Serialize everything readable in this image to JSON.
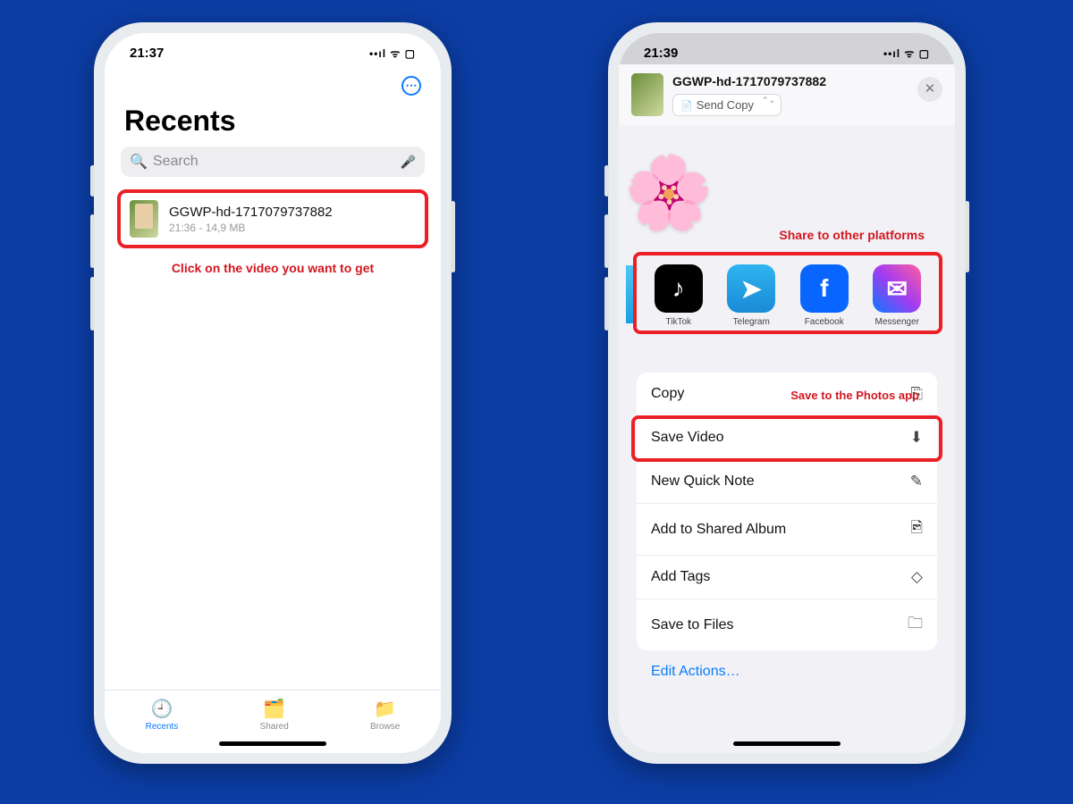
{
  "left": {
    "time": "21:37",
    "signal": "••ıl ᯤ ▢",
    "title": "Recents",
    "search_placeholder": "Search",
    "file": {
      "name": "GGWP-hd-1717079737882",
      "meta": "21:36 - 14,9 MB"
    },
    "caption": "Click on the video you want to get",
    "tabs": {
      "recents": "Recents",
      "shared": "Shared",
      "browse": "Browse"
    }
  },
  "right": {
    "time": "21:39",
    "signal": "••ıl ᯤ ▢",
    "file_name": "GGWP-hd-1717079737882",
    "send_copy": "Send Copy",
    "caption_share": "Share to other platforms",
    "caption_save": "Save to the Photos app",
    "apps": {
      "tiktok": "TikTok",
      "telegram": "Telegram",
      "facebook": "Facebook",
      "messenger": "Messenger"
    },
    "actions": {
      "copy": "Copy",
      "save_video": "Save Video",
      "quick_note": "New Quick Note",
      "shared_album": "Add to Shared Album",
      "add_tags": "Add Tags",
      "save_files": "Save to Files"
    },
    "edit": "Edit Actions…"
  }
}
